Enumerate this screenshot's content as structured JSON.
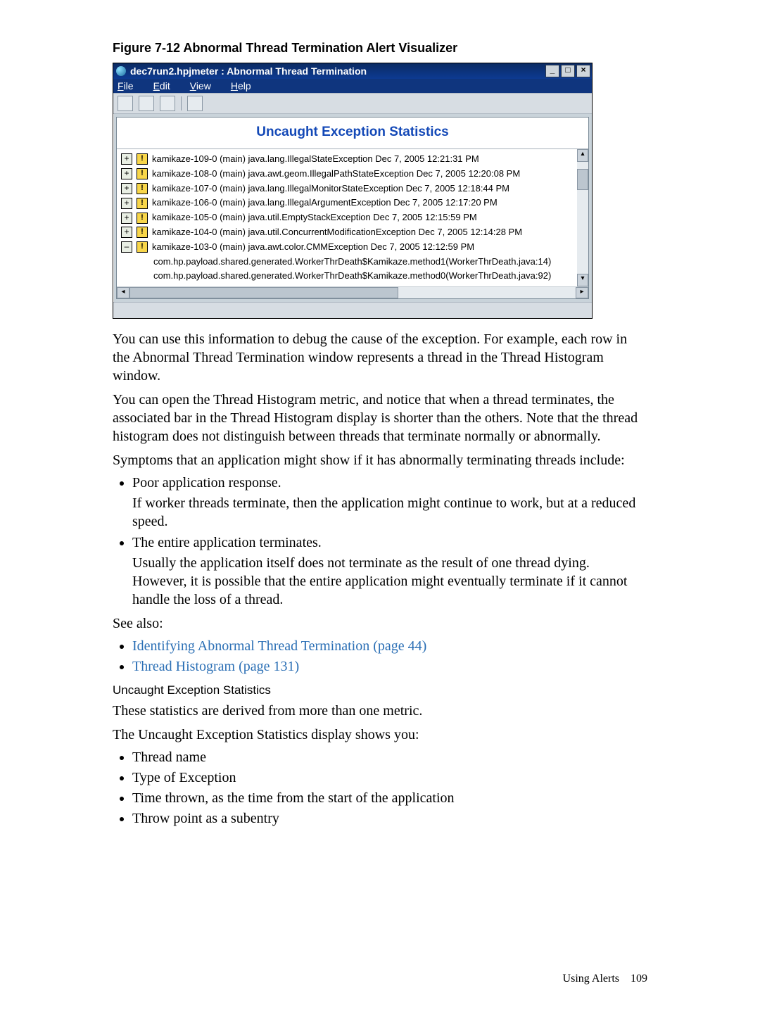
{
  "figure_caption": "Figure 7-12 Abnormal Thread Termination Alert Visualizer",
  "window": {
    "title": "dec7run2.hpjmeter : Abnormal Thread Termination",
    "btn_min": "_",
    "btn_max": "□",
    "btn_close": "×",
    "menu": {
      "file": "File",
      "edit": "Edit",
      "view": "View",
      "help": "Help"
    },
    "heading": "Uncaught Exception Statistics",
    "rows": [
      {
        "plus": "+",
        "text": "kamikaze-109-0 (main)   java.lang.IllegalStateException   Dec 7, 2005 12:21:31 PM"
      },
      {
        "plus": "+",
        "text": "kamikaze-108-0 (main)   java.awt.geom.IllegalPathStateException   Dec 7, 2005 12:20:08 PM"
      },
      {
        "plus": "+",
        "text": "kamikaze-107-0 (main)   java.lang.IllegalMonitorStateException   Dec 7, 2005 12:18:44 PM"
      },
      {
        "plus": "+",
        "text": "kamikaze-106-0 (main)   java.lang.IllegalArgumentException   Dec 7, 2005 12:17:20 PM"
      },
      {
        "plus": "+",
        "text": "kamikaze-105-0 (main)   java.util.EmptyStackException   Dec 7, 2005 12:15:59 PM"
      },
      {
        "plus": "+",
        "text": "kamikaze-104-0 (main)   java.util.ConcurrentModificationException   Dec 7, 2005 12:14:28 PM"
      },
      {
        "plus": "–",
        "text": "kamikaze-103-0 (main)   java.awt.color.CMMException   Dec 7, 2005 12:12:59 PM"
      }
    ],
    "sublines": [
      "com.hp.payload.shared.generated.WorkerThrDeath$Kamikaze.method1(WorkerThrDeath.java:14)",
      "com.hp.payload.shared.generated.WorkerThrDeath$Kamikaze.method0(WorkerThrDeath.java:92)"
    ]
  },
  "para1": "You can use this information to debug the cause of the exception. For example, each row in the Abnormal Thread Termination window represents a thread in the Thread Histogram window.",
  "para2": "You can open the Thread Histogram metric, and notice that when a thread terminates, the associated bar in the Thread Histogram display is shorter than the others. Note that the thread histogram does not distinguish between threads that terminate normally or abnormally.",
  "para3": "Symptoms that an application might show if it has abnormally terminating threads include:",
  "sym1_title": "Poor application response.",
  "sym1_body": "If worker threads terminate, then the application might continue to work, but at a reduced speed.",
  "sym2_title": "The entire application terminates.",
  "sym2_body": "Usually the application itself does not terminate as the result of one thread dying. However, it is possible that the entire application might eventually terminate if it cannot handle the loss of a thread.",
  "see_also_label": "See also:",
  "see_also": [
    "Identifying Abnormal Thread Termination (page 44)",
    "Thread Histogram (page 131)"
  ],
  "subhead": "Uncaught Exception Statistics",
  "para4": "These statistics are derived from more than one metric.",
  "para5": "The Uncaught Exception Statistics display shows you:",
  "shows": [
    "Thread name",
    "Type of Exception",
    "Time thrown, as the time from the start of the application",
    "Throw point as a subentry"
  ],
  "footer_text": "Using Alerts",
  "footer_page": "109"
}
